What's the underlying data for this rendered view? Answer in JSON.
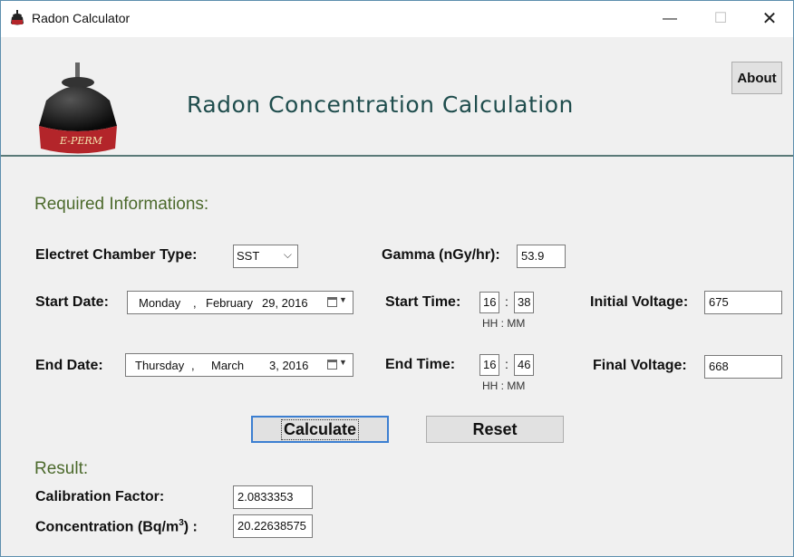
{
  "window": {
    "title": "Radon Calculator",
    "controls": {
      "minimize": "—",
      "maximize": "☐",
      "close": "✕"
    }
  },
  "header": {
    "title": "Radon Concentration Calculation",
    "about_label": "About",
    "logo_icon": "e-perm-chamber-icon",
    "logo_text": "E-PERM"
  },
  "required": {
    "heading": "Required Informations:",
    "chamber_type_label": "Electret Chamber Type:",
    "chamber_type_value": "SST",
    "gamma_label": "Gamma (nGy/hr):",
    "gamma_value": "53.9",
    "start_date_label": "Start Date:",
    "start_date": {
      "day": "Monday",
      "sep1": ",",
      "month": "February",
      "date": "29, 2016"
    },
    "start_time_label": "Start Time:",
    "start_time": {
      "hh": "16",
      "mm": "38"
    },
    "time_colon": ":",
    "time_hint": "HH : MM",
    "initial_voltage_label": "Initial Voltage:",
    "initial_voltage_value": "675",
    "end_date_label": "End Date:",
    "end_date": {
      "day": "Thursday",
      "sep1": ",",
      "month": "March",
      "date": "3, 2016"
    },
    "end_time_label": "End Time:",
    "end_time": {
      "hh": "16",
      "mm": "46"
    },
    "final_voltage_label": "Final Voltage:",
    "final_voltage_value": "668"
  },
  "actions": {
    "calculate_label": "Calculate",
    "reset_label": "Reset"
  },
  "result": {
    "heading": "Result:",
    "calibration_label": "Calibration Factor:",
    "calibration_value": "2.0833353",
    "concentration_label_pre": "Concentration (Bq/m",
    "concentration_sup": "3",
    "concentration_label_post": ") :",
    "concentration_value": "20.22638575"
  },
  "colors": {
    "title_color": "#1f4d4d",
    "section_color": "#4c6a2c",
    "focus_border": "#3c7fd1"
  }
}
